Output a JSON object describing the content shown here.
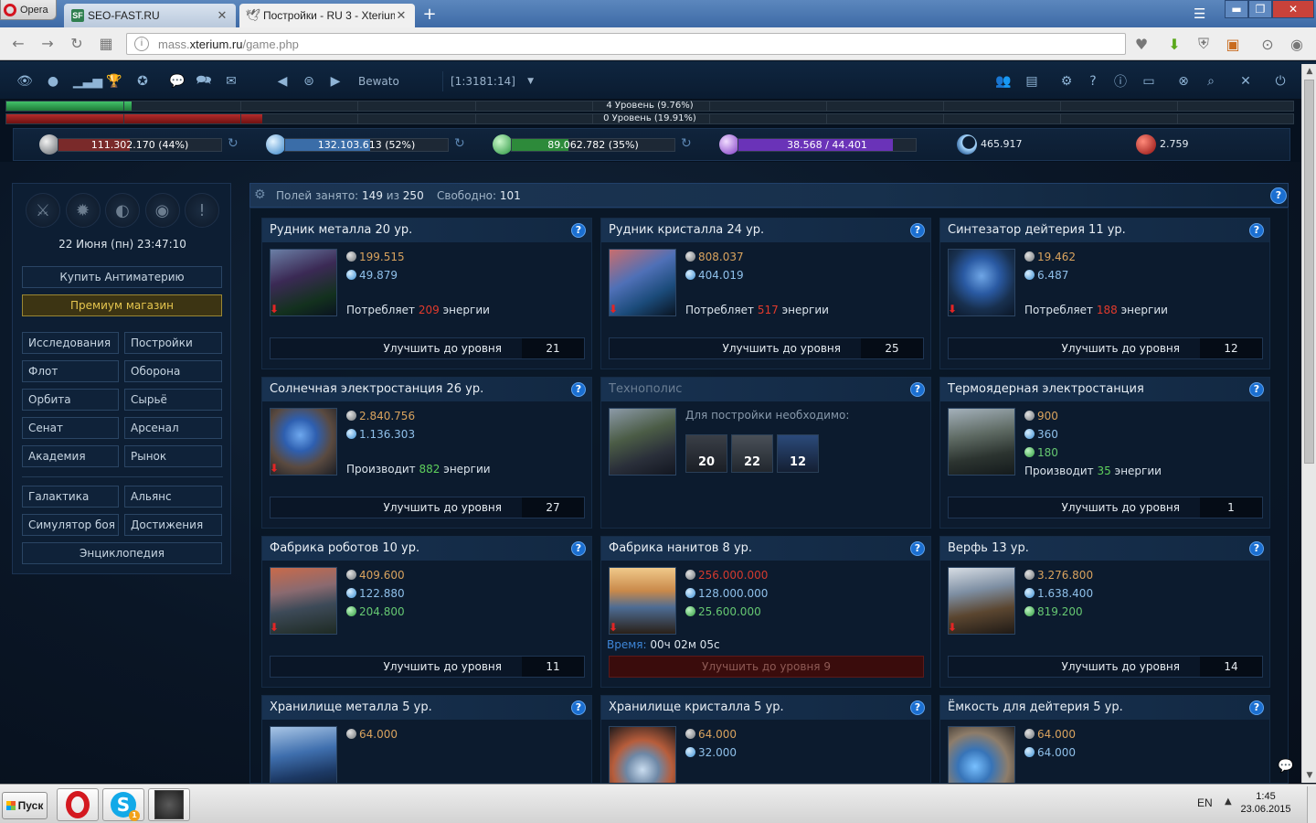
{
  "browser": {
    "menu_label": "Opera",
    "tabs": [
      {
        "label": "SEO-FAST.RU",
        "favicon": "SF"
      },
      {
        "label": "Постройки - RU 3 - Xterium"
      }
    ],
    "url_prefix": "mass.",
    "url_domain": "xterium.ru",
    "url_path": "/game.php"
  },
  "game": {
    "planet_name": "Bewato",
    "planet_coords": "[1:3181:14]",
    "level_bars": [
      {
        "text": "4 Уровень (9.76%)",
        "fraction": 0.0976,
        "color": "#2fa552"
      },
      {
        "text": "0 Уровень (19.91%)",
        "fraction": 0.1991,
        "color": "#9b2020"
      }
    ],
    "resources": {
      "metal": {
        "text": "111.302.170 (44%)",
        "fraction": 0.44
      },
      "crystal": {
        "text": "132.103.613 (52%)",
        "fraction": 0.52
      },
      "deuterium": {
        "text": "89.062.782 (35%)",
        "fraction": 0.35
      },
      "energy": {
        "current": "38.568",
        "max": "44.401",
        "fraction": 0.8686
      },
      "darkmatter": "465.917",
      "antimatter": "2.759"
    },
    "left_panel": {
      "datetime": "22 Июня (пн) 23:47:10",
      "buy_antimatter": "Купить Антиматерию",
      "premium_shop": "Премиум магазин",
      "menu": [
        [
          "Исследования",
          "Постройки"
        ],
        [
          "Флот",
          "Оборона"
        ],
        [
          "Орбита",
          "Сырьё"
        ],
        [
          "Сенат",
          "Арсенал"
        ],
        [
          "Академия",
          "Рынок"
        ]
      ],
      "menu2": [
        [
          "Галактика",
          "Альянс"
        ],
        [
          "Симулятор боя",
          "Достижения"
        ]
      ],
      "encyclopedia": "Энциклопедия"
    },
    "fields": {
      "label_used": "Полей занято:",
      "used": "149",
      "of": "из",
      "total": "250",
      "label_free": "Свободно:",
      "free": "101"
    },
    "upgrade_label": "Улучшить до уровня",
    "energy_consumes": "Потребляет",
    "energy_produces": "Производит",
    "energy_word": "энергии",
    "buildings": [
      {
        "title": "Рудник металла 20 ур.",
        "metal": "199.515",
        "crystal": "49.879",
        "energy_verb": "Потребляет",
        "energy": "209",
        "next": "21"
      },
      {
        "title": "Рудник кристалла 24 ур.",
        "metal": "808.037",
        "crystal": "404.019",
        "energy_verb": "Потребляет",
        "energy": "517",
        "next": "25"
      },
      {
        "title": "Синтезатор дейтерия 11 ур.",
        "metal": "19.462",
        "crystal": "6.487",
        "energy_verb": "Потребляет",
        "energy": "188",
        "next": "12"
      },
      {
        "title": "Солнечная электростанция 26 ур.",
        "metal": "2.840.756",
        "crystal": "1.136.303",
        "energy_verb": "Производит",
        "energy": "882",
        "next": "27"
      },
      {
        "title": "Технополис",
        "requirement": "Для постройки необходимо:",
        "req_levels": [
          "20",
          "22",
          "12"
        ]
      },
      {
        "title": "Термоядерная электростанция",
        "metal": "900",
        "crystal": "360",
        "deuterium": "180",
        "energy_verb": "Производит",
        "energy": "35",
        "next": "1"
      },
      {
        "title": "Фабрика роботов 10 ур.",
        "metal": "409.600",
        "crystal": "122.880",
        "deuterium": "204.800",
        "next": "11"
      },
      {
        "title": "Фабрика нанитов 8 ур.",
        "metal": "256.000.000",
        "crystal": "128.000.000",
        "deuterium": "25.600.000",
        "time_label": "Время:",
        "time": "00ч 02м 05с",
        "busy_label": "Улучшить до уровня 9"
      },
      {
        "title": "Верфь 13 ур.",
        "metal": "3.276.800",
        "crystal": "1.638.400",
        "deuterium": "819.200",
        "next": "14"
      },
      {
        "title": "Хранилище металла 5 ур.",
        "metal": "64.000"
      },
      {
        "title": "Хранилище кристалла 5 ур.",
        "metal": "64.000",
        "crystal": "32.000"
      },
      {
        "title": "Ёмкость для дейтерия 5 ур.",
        "metal": "64.000",
        "crystal": "64.000"
      }
    ]
  },
  "taskbar": {
    "start": "Пуск",
    "skype_badge": "1",
    "lang": "EN",
    "time": "1:45",
    "date": "23.06.2015"
  },
  "icons": [
    "overview-eye-icon",
    "empire-icon",
    "stats-icon",
    "trophy-icon",
    "medal-icon",
    "chat-icon",
    "messages-icon",
    "mail-icon",
    "prev-planet-icon",
    "planet-list-icon",
    "next-planet-icon",
    "alliance-icon",
    "notes-icon",
    "settings-icon",
    "help-icon",
    "info-icon",
    "screen-icon",
    "support-icon",
    "search-icon",
    "tools-icon",
    "logout-icon"
  ]
}
